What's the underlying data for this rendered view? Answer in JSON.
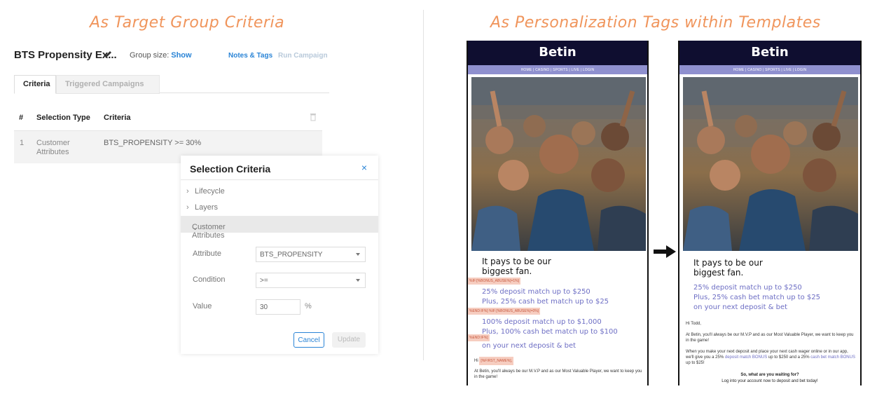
{
  "headings": {
    "left": "As Target Group Criteria",
    "right": "As Personalization Tags within Templates"
  },
  "campaign": {
    "title": "BTS Propensity Ex...",
    "group_size_label": "Group size:",
    "group_size_link": "Show",
    "notes_tags": "Notes & Tags",
    "run_campaign": "Run Campaign",
    "tabs": [
      "Criteria",
      "Triggered Campaigns"
    ],
    "table": {
      "headers": [
        "#",
        "Selection Type",
        "Criteria"
      ],
      "rows": [
        {
          "num": "1",
          "type": "Customer Attributes",
          "criteria": "BTS_PROPENSITY >= 30%"
        }
      ]
    }
  },
  "modal": {
    "title": "Selection Criteria",
    "close": "×",
    "items": [
      "Lifecycle",
      "Layers"
    ],
    "expanded": "Customer Attributes",
    "attribute_label": "Attribute",
    "attribute_value": "BTS_PROPENSITY",
    "condition_label": "Condition",
    "condition_value": ">=",
    "value_label": "Value",
    "value_value": "30",
    "value_unit": "%",
    "cancel": "Cancel",
    "update": "Update"
  },
  "email": {
    "brand": "Betin",
    "nav": "HOME | CASINO | SPORTS | LIVE | LOGIN",
    "headline_1": "It pays to be our",
    "headline_2": "biggest fan.",
    "offer_a_1": "25% deposit match up to $250",
    "offer_a_2": "Plus, 25% cash bet match up to $25",
    "offer_b_1": "100% deposit match up to $1,000",
    "offer_b_2": "Plus, 100% cash bet match up to $100",
    "offer_tail": "on your next deposit & bet",
    "tag_if": "%IF:[%BONUS_ABUSE%]=1%]",
    "tag_else": "%END:IF%] %IF:[%BONUS_ABUSE%]=0%]",
    "tag_end": "%END:IF%]",
    "greeting_prefix": "Hi",
    "tag_first_name": "[%FIRST_NAME%],",
    "body_1": "At Betin, you'll always be our M.V.P and as our Most Valuable Player, we want to keep you in the game!",
    "greeting_resolved": "Hi Todd,",
    "body_2_pre": "When you make your next deposit and place your next cash wager online or in our app, we'll  give you a 25%",
    "body_2_link_1": "deposit match BONUS",
    "body_2_mid": "up to $250 and a 25%",
    "body_2_link_2": "cash bet match BONUS",
    "body_2_post": "up to $25!",
    "cta_1": "So, what are you waiting for?",
    "cta_2": "Log into your account now to deposit and bet today!"
  },
  "colors": {
    "heading_orange": "#f0955c",
    "link_blue": "#2a84d6",
    "email_navy": "#0f0e30",
    "email_nav_purple": "#8f90cf",
    "offer_purple": "#6d6ec4",
    "tag_bg": "#f6cdc0"
  }
}
